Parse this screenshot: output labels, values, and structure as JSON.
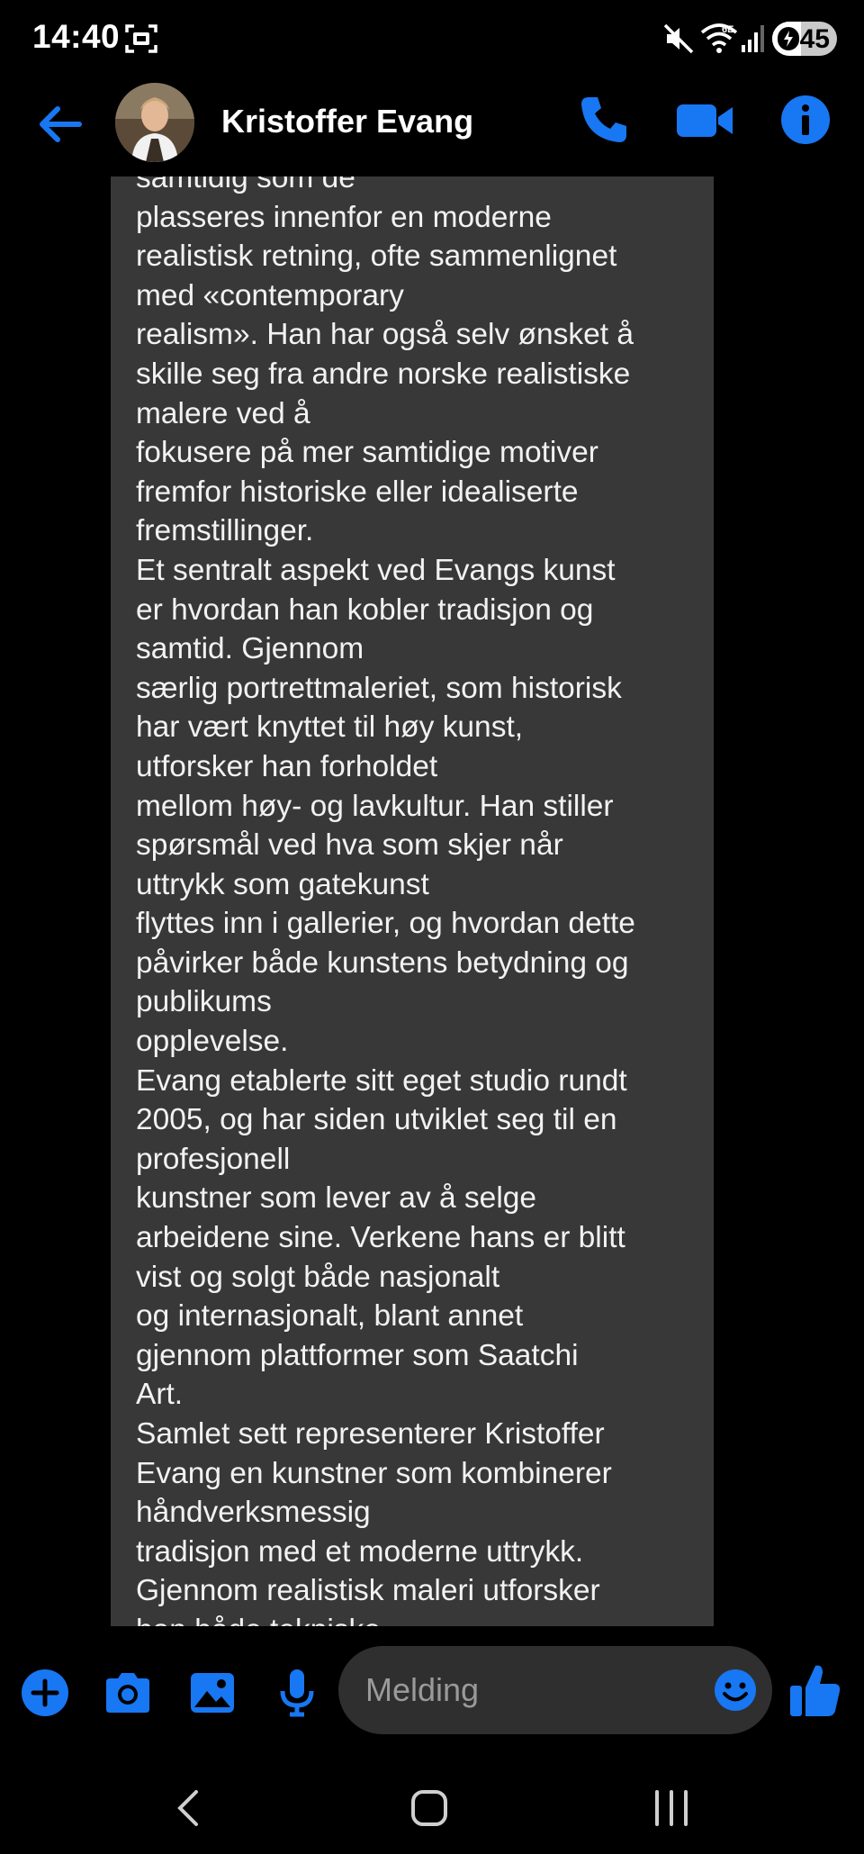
{
  "status_bar": {
    "time": "14:40",
    "battery": "45",
    "battery_level": 0.45,
    "icons": [
      "screen-record-icon",
      "mute-icon",
      "wifi-6e-icon",
      "signal-icon",
      "battery-icon"
    ]
  },
  "header": {
    "contact_name": "Kristoffer Evang",
    "icons": [
      "back-arrow-icon",
      "phone-icon",
      "video-camera-icon",
      "info-icon"
    ]
  },
  "message": {
    "lines": [
      "samtidig som de",
      "plasseres innenfor en moderne",
      "realistisk retning, ofte sammenlignet",
      "med «contemporary",
      "realism». Han har også selv ønsket å",
      "skille seg fra andre norske realistiske",
      "malere ved å",
      "fokusere på mer samtidige motiver",
      "fremfor historiske eller idealiserte",
      "fremstillinger.",
      "Et sentralt aspekt ved Evangs kunst",
      "er hvordan han kobler tradisjon og",
      "samtid. Gjennom",
      "særlig portrettmaleriet, som historisk",
      "har vært knyttet til høy kunst,",
      "utforsker han forholdet",
      "mellom høy- og lavkultur. Han stiller",
      "spørsmål ved hva som skjer når",
      "uttrykk som gatekunst",
      "flyttes inn i gallerier, og hvordan dette",
      "påvirker både kunstens betydning og",
      "publikums",
      "opplevelse.",
      "Evang etablerte sitt eget studio rundt",
      "2005, og har siden utviklet seg til en",
      "profesjonell",
      "kunstner som lever av å selge",
      "arbeidene sine. Verkene hans er blitt",
      "vist og solgt både nasjonalt",
      "og internasjonalt, blant annet",
      "gjennom plattformer som Saatchi",
      "Art.",
      "Samlet sett representerer Kristoffer",
      "Evang en kunstner som kombinerer",
      "håndverksmessig",
      "tradisjon med et moderne uttrykk.",
      "Gjennom realistisk maleri utforsker",
      "han både tekniske"
    ]
  },
  "composer": {
    "placeholder": "Melding",
    "icons": [
      "plus-icon",
      "camera-icon",
      "image-icon",
      "microphone-icon",
      "emoji-icon",
      "thumbs-up-icon"
    ]
  },
  "colors": {
    "accent": "#1877f2",
    "bubble": "#383838",
    "background": "#000000"
  }
}
